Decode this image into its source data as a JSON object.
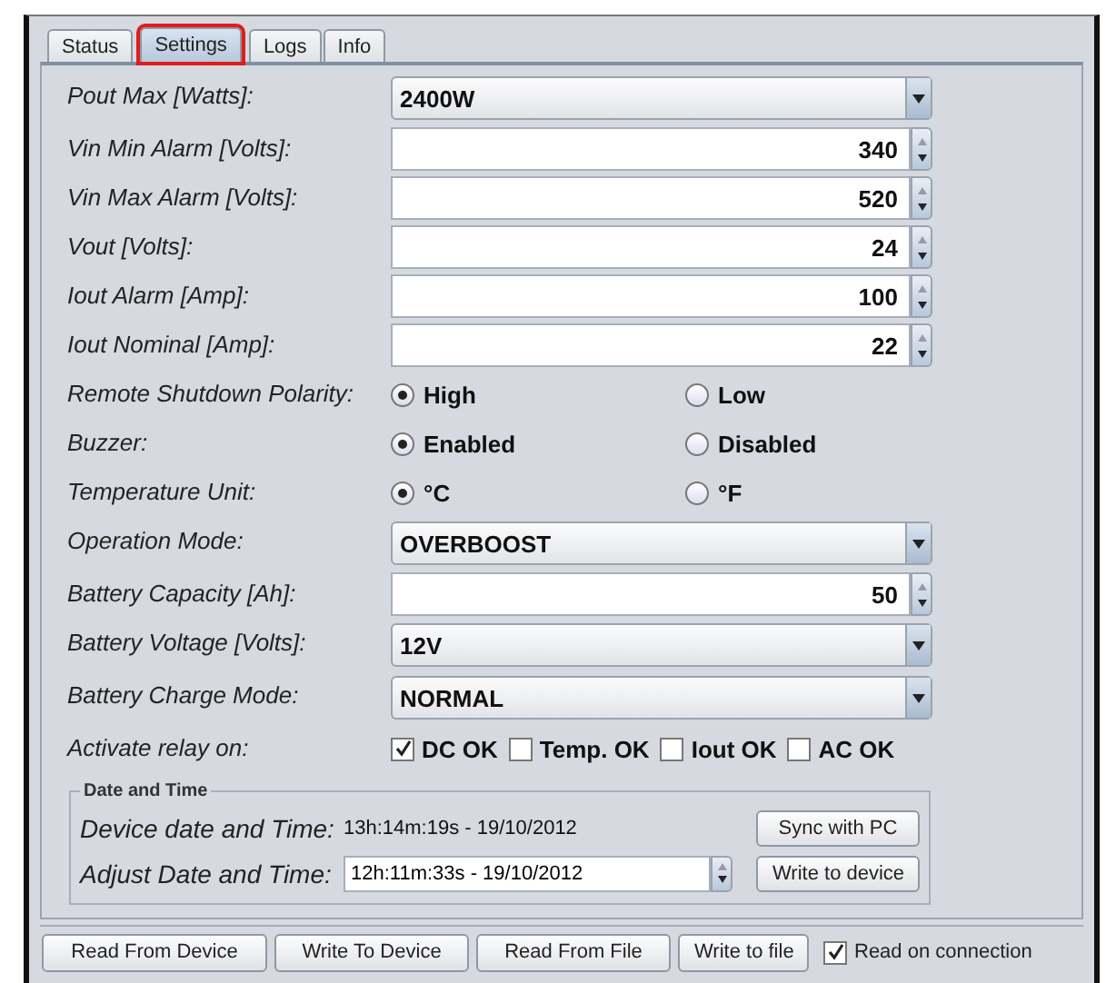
{
  "tabs": [
    {
      "label": "Status",
      "selected": false
    },
    {
      "label": "Settings",
      "selected": true
    },
    {
      "label": "Logs",
      "selected": false
    },
    {
      "label": "Info",
      "selected": false
    }
  ],
  "rows": [
    {
      "kind": "combo",
      "label": "Pout Max [Watts]:",
      "value": "2400W"
    },
    {
      "kind": "spinner",
      "label": "Vin Min Alarm [Volts]:",
      "value": "340"
    },
    {
      "kind": "spinner",
      "label": "Vin Max Alarm [Volts]:",
      "value": "520"
    },
    {
      "kind": "spinner",
      "label": "Vout [Volts]:",
      "value": "24"
    },
    {
      "kind": "spinner",
      "label": "Iout Alarm [Amp]:",
      "value": "100"
    },
    {
      "kind": "spinner",
      "label": "Iout Nominal [Amp]:",
      "value": "22"
    },
    {
      "kind": "radio",
      "label": "Remote Shutdown Polarity:",
      "options": [
        {
          "label": "High",
          "selected": true
        },
        {
          "label": "Low",
          "selected": false
        }
      ]
    },
    {
      "kind": "radio",
      "label": "Buzzer:",
      "options": [
        {
          "label": "Enabled",
          "selected": true
        },
        {
          "label": "Disabled",
          "selected": false
        }
      ]
    },
    {
      "kind": "radio",
      "label": "Temperature Unit:",
      "options": [
        {
          "label": "°C",
          "selected": true
        },
        {
          "label": "°F",
          "selected": false
        }
      ]
    },
    {
      "kind": "combo",
      "label": "Operation Mode:",
      "value": "OVERBOOST"
    },
    {
      "kind": "spinner",
      "label": "Battery Capacity [Ah]:",
      "value": "50"
    },
    {
      "kind": "combo",
      "label": "Battery Voltage [Volts]:",
      "value": "12V"
    },
    {
      "kind": "combo",
      "label": "Battery Charge Mode:",
      "value": "NORMAL"
    },
    {
      "kind": "checks",
      "label": "Activate relay on:",
      "options": [
        {
          "label": "DC OK",
          "checked": true
        },
        {
          "label": "Temp. OK",
          "checked": false
        },
        {
          "label": "Iout OK",
          "checked": false
        },
        {
          "label": "AC OK",
          "checked": false
        }
      ]
    }
  ],
  "date_group": {
    "title": "Date and Time",
    "device_label": "Device date and Time:",
    "device_value": "13h:14m:19s - 19/10/2012",
    "sync_button": "Sync with PC",
    "adjust_label": "Adjust Date and Time:",
    "adjust_value": "12h:11m:33s - 19/10/2012",
    "write_button": "Write to device"
  },
  "bottom_buttons": [
    "Read From Device",
    "Write To Device",
    "Read From File",
    "Write to file"
  ],
  "read_on_connection": {
    "label": "Read on connection",
    "checked": true
  }
}
